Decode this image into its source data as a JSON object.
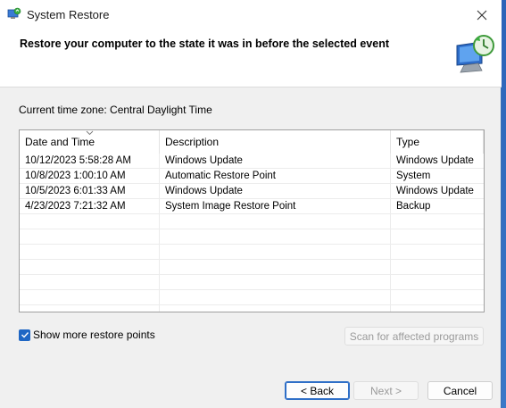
{
  "window": {
    "title": "System Restore"
  },
  "header": {
    "text": "Restore your computer to the state it was in before the selected event"
  },
  "timezone_label": "Current time zone: Central Daylight Time",
  "table": {
    "columns": [
      "Date and Time",
      "Description",
      "Type"
    ],
    "rows": [
      {
        "date": "10/12/2023 5:58:28 AM",
        "description": "Windows Update",
        "type": "Windows Update"
      },
      {
        "date": "10/8/2023 1:00:10 AM",
        "description": "Automatic Restore Point",
        "type": "System"
      },
      {
        "date": "10/5/2023 6:01:33 AM",
        "description": "Windows Update",
        "type": "Windows Update"
      },
      {
        "date": "4/23/2023 7:21:32 AM",
        "description": "System Image Restore Point",
        "type": "Backup"
      }
    ]
  },
  "options": {
    "show_more_label": "Show more restore points",
    "show_more_checked": true
  },
  "buttons": {
    "scan": "Scan for affected programs",
    "back": "< Back",
    "next": "Next >",
    "cancel": "Cancel"
  },
  "colors": {
    "accent": "#1e66c4",
    "titlebar": "#ffffff",
    "dialog_bg": "#f0f0f0"
  }
}
